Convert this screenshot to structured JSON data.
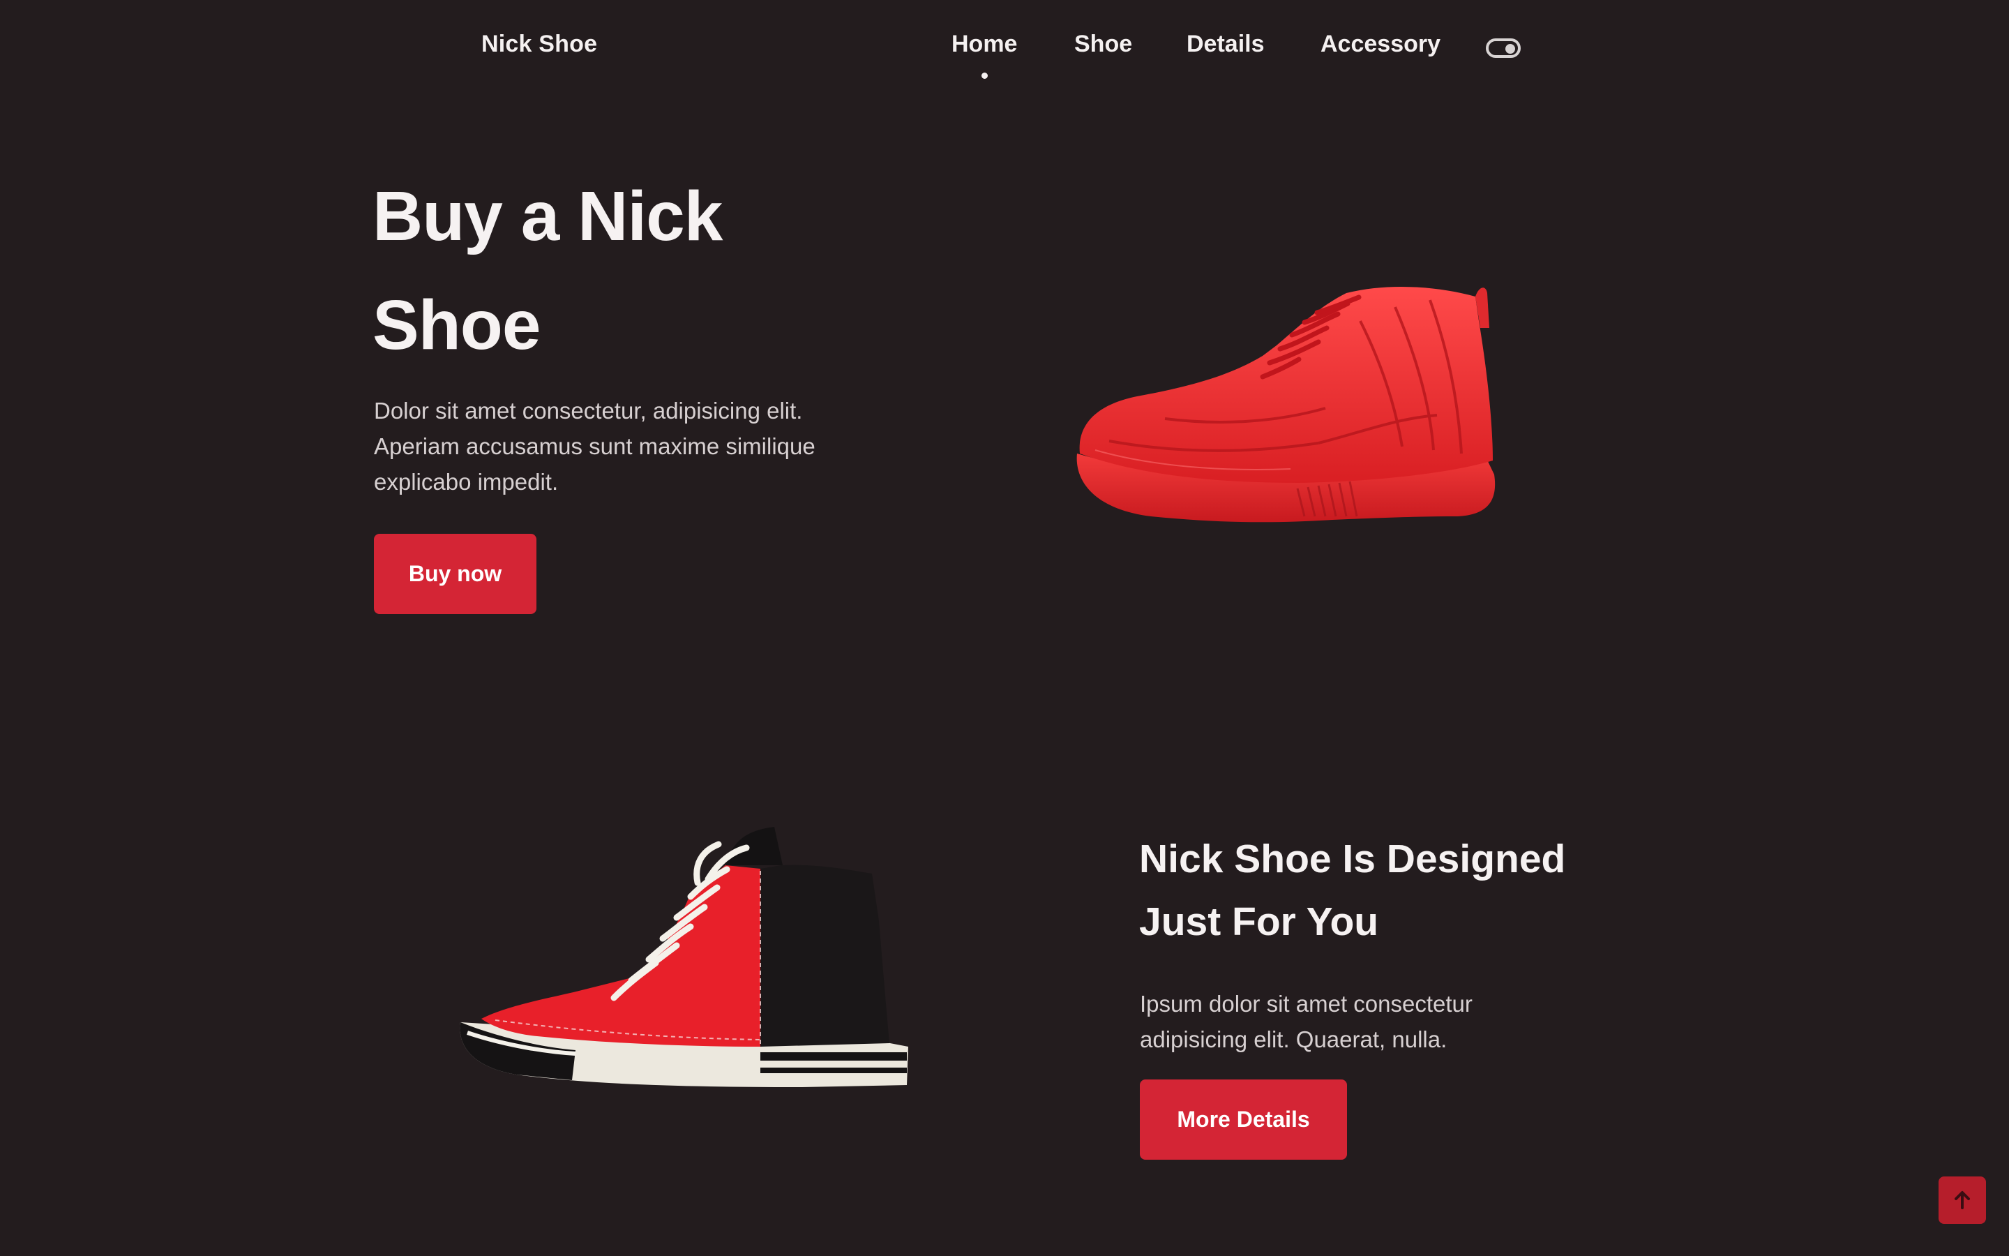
{
  "header": {
    "logo": "Nick Shoe",
    "nav": [
      {
        "label": "Home",
        "active": true
      },
      {
        "label": "Shoe",
        "active": false
      },
      {
        "label": "Details",
        "active": false
      },
      {
        "label": "Accessory",
        "active": false
      }
    ],
    "theme_toggle_icon": "toggle-icon"
  },
  "hero": {
    "title_line1": "Buy a Nick",
    "title_line2": "Shoe",
    "description_line1": "Dolor sit amet consectetur, adipisicing elit.",
    "description_line2": "Aperiam accusamus sunt maxime similique",
    "description_line3": "explicabo impedit.",
    "button_label": "Buy now",
    "image": "red-high-top-sneaker"
  },
  "feature": {
    "title_line1": "Nick Shoe Is Designed",
    "title_line2": "Just For You",
    "description_line1": "Ipsum dolor sit amet consectetur",
    "description_line2": "adipisicing elit. Quaerat, nulla.",
    "button_label": "More Details",
    "image": "red-black-canvas-sneaker"
  },
  "scroll_up_icon": "arrow-up-icon",
  "colors": {
    "background": "#231c1e",
    "accent": "#d42535",
    "text": "#f3efef",
    "muted_text": "#d7d0d1"
  }
}
